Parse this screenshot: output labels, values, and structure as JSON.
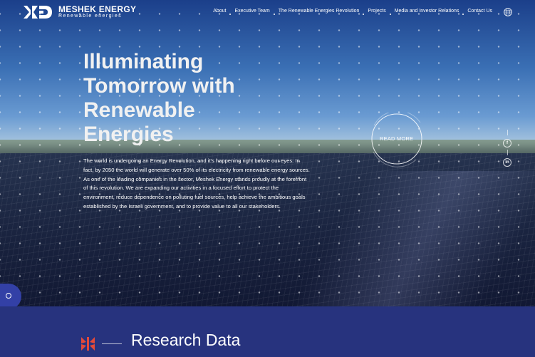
{
  "brand": {
    "name": "MESHEK ENERGY",
    "tagline": "Renewable energies",
    "accent_color": "#27337e",
    "logo_red": "#e34a3a"
  },
  "nav": {
    "items": [
      {
        "label": "About"
      },
      {
        "label": "Executive Team"
      },
      {
        "label": "The Renewable Energies Revolution"
      },
      {
        "label": "Projects"
      },
      {
        "label": "Media and Investor Relations"
      },
      {
        "label": "Contact Us"
      }
    ],
    "language_icon": "globe-icon"
  },
  "hero": {
    "title": "Illuminating Tomorrow with Renewable Energies",
    "paragraph_1": "The world is undergoing an Energy Revolution, and it's happening right before our eyes: In fact, by 2050 the world will generate over 50% of its electricity from renewable energy sources.",
    "paragraph_2": "As one of the leading companies in the sector, Meshek Energy stands proudly at the forefront of this revolution. We are expanding our activities in a focused effort to protect the environment, reduce dependence on polluting fuel sources, help achieve the ambitious goals established by the Israeli government, and to provide value to all our stakeholders.",
    "cta_label": "READ MORE"
  },
  "social": {
    "facebook": "f",
    "linkedin": "in"
  },
  "accessibility": {
    "icon": "accessibility-icon"
  },
  "research": {
    "title": "Research Data"
  }
}
